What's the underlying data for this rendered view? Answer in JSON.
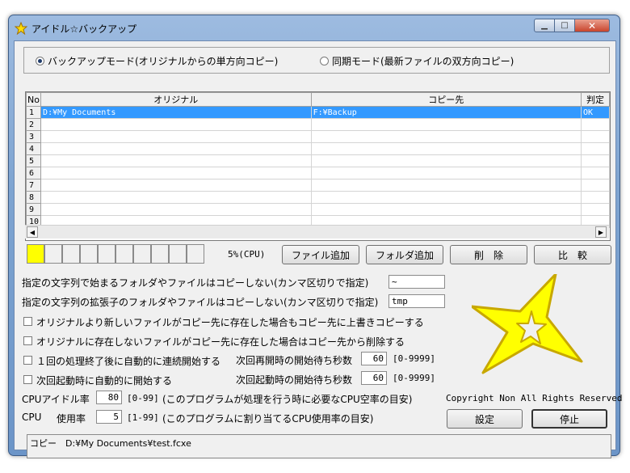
{
  "window": {
    "title": "アイドル☆バックアップ"
  },
  "mode": {
    "backup_label": "バックアップモード(オリジナルからの単方向コピー)",
    "sync_label": "同期モード(最新ファイルの双方向コピー)",
    "selected": "backup"
  },
  "table": {
    "headers": {
      "no": "No",
      "original": "オリジナル",
      "copy": "コピー先",
      "judge": "判定"
    },
    "rows": [
      {
        "no": "1",
        "original": "D:¥My Documents",
        "copy": "F:¥Backup",
        "judge": "OK"
      },
      {
        "no": "2",
        "original": "",
        "copy": "",
        "judge": ""
      },
      {
        "no": "3",
        "original": "",
        "copy": "",
        "judge": ""
      },
      {
        "no": "4",
        "original": "",
        "copy": "",
        "judge": ""
      },
      {
        "no": "5",
        "original": "",
        "copy": "",
        "judge": ""
      },
      {
        "no": "6",
        "original": "",
        "copy": "",
        "judge": ""
      },
      {
        "no": "7",
        "original": "",
        "copy": "",
        "judge": ""
      },
      {
        "no": "8",
        "original": "",
        "copy": "",
        "judge": ""
      },
      {
        "no": "9",
        "original": "",
        "copy": "",
        "judge": ""
      },
      {
        "no": "10",
        "original": "",
        "copy": "",
        "judge": ""
      }
    ]
  },
  "cpu_meter": {
    "cells": 10,
    "filled": 1,
    "label": "5%(CPU)"
  },
  "buttons": {
    "add_file": "ファイル追加",
    "add_folder": "フォルダ追加",
    "delete": "削　除",
    "compare": "比　較",
    "settings": "設定",
    "stop": "停止"
  },
  "exclude": {
    "prefix_label": "指定の文字列で始まるフォルダやファイルはコピーしない(カンマ区切りで指定)",
    "prefix_value": "~",
    "ext_label": "指定の文字列の拡張子のフォルダやファイルはコピーしない(カンマ区切りで指定)",
    "ext_value": "tmp"
  },
  "options": {
    "overwrite_newer": "オリジナルより新しいファイルがコピー先に存在した場合もコピー先に上書きコピーする",
    "delete_missing": "オリジナルに存在しないファイルがコピー先に存在した場合はコピー先から削除する",
    "auto_continue": "１回の処理終了後に自動的に連続開始する",
    "restart_wait_label": "次回再開時の開始待ち秒数",
    "restart_wait_value": "60",
    "restart_wait_range": "[0-9999]",
    "auto_start": "次回起動時に自動的に開始する",
    "startup_wait_label": "次回起動時の開始待ち秒数",
    "startup_wait_value": "60",
    "startup_wait_range": "[0-9999]"
  },
  "cpu": {
    "idle_label": "CPUアイドル率",
    "idle_value": "80",
    "idle_range": "[0-99]",
    "idle_note": "(このプログラムが処理を行う時に必要なCPU空率の目安)",
    "usage_label_a": "CPU",
    "usage_label_b": "使用率",
    "usage_value": "5",
    "usage_range": "[1-99]",
    "usage_note": "(このプログラムに割り当てるCPU使用率の目安)"
  },
  "copyright": "Copyright Non All Rights Reserved",
  "status": "コピー　D:¥My Documents¥test.fcxe",
  "colors": {
    "star_fill": "#ffff00",
    "star_stroke": "#c8a800",
    "selection": "#3399ff",
    "meter_on": "#ffff00"
  }
}
